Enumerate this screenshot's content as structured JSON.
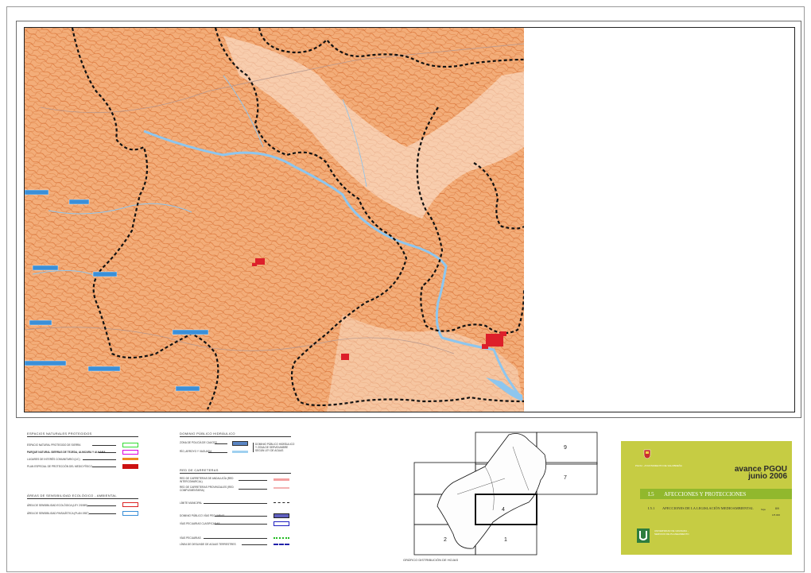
{
  "legend": {
    "group1": {
      "title": "ESPACIOS NATURALES PROTEGIDOS",
      "items": [
        {
          "label": "ESPACIO NATURAL PROTEGIDO DE SIERRA",
          "color": "#33dd33"
        },
        {
          "label": "PARQUE NATURAL SIERRAS DE TEJEDA, ALMIJARA Y ALHAMA",
          "color": "#dd00dd"
        },
        {
          "label": "LUGARES DE INTERÉS COMUNITARIO (LIC)",
          "color": "#f08a1e"
        },
        {
          "label": "PLAN ESPECIAL DE PROTECCIÓN DEL MEDIO FÍSICO",
          "color": "#cc1111"
        }
      ]
    },
    "group2": {
      "title": "ÁREAS DE SENSIBILIDAD ECOLÓGICO - AMBIENTAL",
      "items": [
        {
          "label": "ÁREA DE SENSIBILIDAD ECOLÓGICA (LEY 2/1989)",
          "color": "#dd2222"
        },
        {
          "label": "ÁREA DE SENSIBILIDAD PAISAJÍSTICA (PLAN 1987)",
          "color": "#3a8fd8"
        }
      ]
    },
    "group3": {
      "title": "DOMINIO PÚBLICO HIDRÁULICO",
      "items": [
        {
          "label": "ZONA DE POLICÍA DE CAUCES",
          "color": "#5b86c4"
        },
        {
          "label": "RÍO, ARROYO Y VAGUADA",
          "color": "#9fd0f0"
        }
      ],
      "note": "DOMINIO PÚBLICO HIDRÁULICO Y ZONA DE SERVIDUMBRE SEGÚN LEY DE AGUAS"
    },
    "group4": {
      "title": "RED DE CARRETERAS",
      "items": [
        {
          "label": "RED DE CARRETERAS DE ANDALUCÍA (RED INTERCOMARCAL)",
          "color": "#f4a0a0"
        },
        {
          "label": "RED DE CARRETERAS PROVINCIALES (RED COMPLEMENTARIA)",
          "color": "#f4b3b3"
        },
        {
          "label": "LÍMITE MUNICIPAL",
          "color": "#222222"
        },
        {
          "label": "DOMINIO PÚBLICO VÍAS PECUARIAS",
          "color": "#6060c0"
        },
        {
          "label": "VÍAS PECUARIAS CLASIFICADAS",
          "color": "#2020c0"
        },
        {
          "label": "VÍAS PECUARIAS",
          "color": "#22bb22"
        },
        {
          "label": "LÍNEA DE DESLINDE DE AGUAS TERRESTRES",
          "color": "#2222aa"
        }
      ]
    }
  },
  "key_map": {
    "sheet_numbers": [
      "1",
      "2",
      "4",
      "7",
      "9"
    ],
    "caption": "GRÁFICO DISTRIBUCIÓN DE HOJAS"
  },
  "title_card": {
    "org": "PGOU - AYUNTAMIENTO DE SALOBREÑA",
    "plan_label": "avance PGOU",
    "date": "junio 2006",
    "section_number": "I.5",
    "section_title": "AFECCIONES Y PROTECCIONES",
    "sub_number": "I.5.1",
    "sub_title": "AFECCIONES DE LA LEGISLACIÓN MEDIOAMBIENTAL",
    "sheet_label": "hoja",
    "sheet_value": "8/9",
    "scale": "1/5.000",
    "logo_text": "UNIVERSIDAD DE GRANADA - SERVICIO DE PLANEAMIENTO"
  },
  "colors": {
    "terrain": "#f1a26a",
    "contour": "#d96a2a",
    "river": "#8ec6ee",
    "boundary": "#111111",
    "town": "#dd1f2a",
    "card": "#c6cc43",
    "card_band": "#91b82d"
  }
}
